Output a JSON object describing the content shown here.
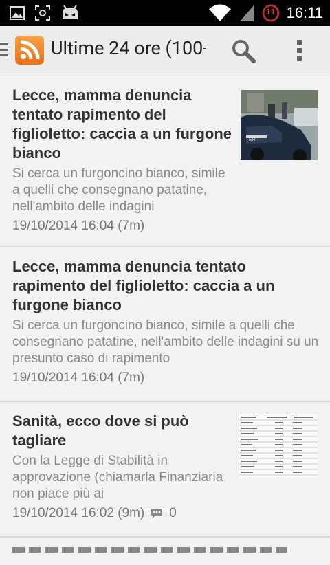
{
  "status_bar": {
    "time": "16:11",
    "notification_badge": "11",
    "icons": [
      "image-icon",
      "screenshot-icon",
      "android-icon",
      "wifi-icon",
      "signal-icon",
      "battery-icon"
    ]
  },
  "action_bar": {
    "title": "Ultime 24 ore (100-",
    "icons": [
      "drawer-icon",
      "rss-icon",
      "search-icon",
      "overflow-menu-icon"
    ]
  },
  "articles": [
    {
      "title": "Lecce, mamma denuncia tentato rapimento del figlioletto: caccia a un furgone bianco",
      "summary": "Si cerca un furgoncino bianco, simile a quelli che consegnano patatine, nell'ambito delle indagini",
      "date": "19/10/2014 16:04 (7m)",
      "has_thumbnail": true
    },
    {
      "title": "Lecce, mamma denuncia tentato rapimento del figlioletto: caccia a un furgone bianco",
      "summary": "Si cerca un furgoncino bianco, simile a quelli che consegnano patatine, nell'ambito delle indagini su un presunto caso di rapimento",
      "date": "19/10/2014 16:04 (7m)",
      "has_thumbnail": false
    },
    {
      "title": "Sanità, ecco dove si può tagliare",
      "summary": "Con la Legge di Stabilità in approvazione (chiamarla Finanziaria non piace più ai",
      "date": "19/10/2014 16:02 (9m)",
      "comments": "0",
      "has_thumbnail": true
    }
  ],
  "colors": {
    "status_bar": "#000000",
    "action_bar": "#ececec",
    "rss_orange": "#f08a2c",
    "title_text": "#333333",
    "summary_text": "#8a8a8a"
  }
}
